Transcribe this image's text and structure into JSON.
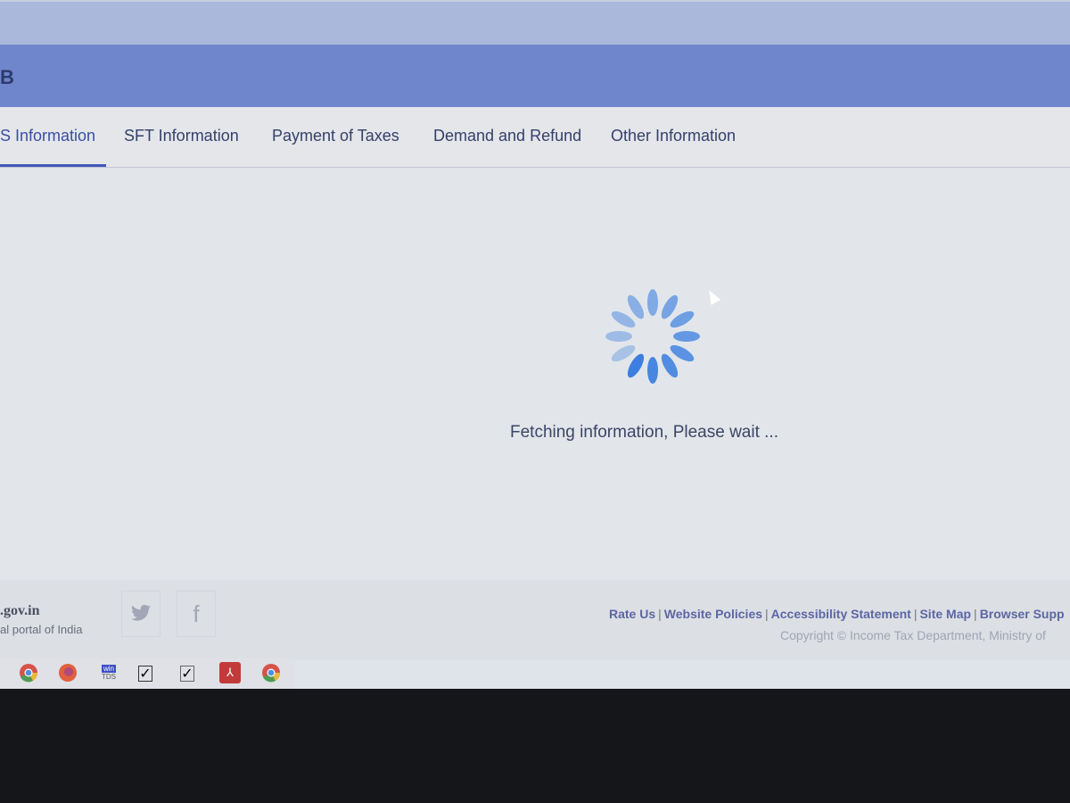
{
  "header": {
    "title": "B"
  },
  "tabs": [
    {
      "label": "S Information",
      "active": true
    },
    {
      "label": "SFT Information"
    },
    {
      "label": "Payment of Taxes"
    },
    {
      "label": "Demand and Refund"
    },
    {
      "label": "Other Information"
    }
  ],
  "main": {
    "loading_text": "Fetching information, Please wait ...",
    "spinner_color": "#3d7fe0"
  },
  "footer": {
    "domain": ".gov.in",
    "tagline": "al portal of India",
    "social": [
      {
        "icon": "twitter-icon"
      },
      {
        "icon": "facebook-icon",
        "glyph": "f"
      }
    ],
    "links": [
      "Rate Us",
      "Website Policies",
      "Accessibility Statement",
      "Site Map",
      "Browser Supp"
    ],
    "copyright": "Copyright © Income Tax Department, Ministry of"
  },
  "taskbar": {
    "apps": [
      {
        "icon": "chrome-icon"
      },
      {
        "icon": "firefox-icon"
      },
      {
        "icon": "wintds-icon",
        "label_top": "win",
        "label_bottom": "TDS"
      },
      {
        "icon": "checkbox-app-icon"
      },
      {
        "icon": "checkbox-app-icon"
      },
      {
        "icon": "acrobat-icon"
      },
      {
        "icon": "chrome-icon"
      }
    ]
  }
}
